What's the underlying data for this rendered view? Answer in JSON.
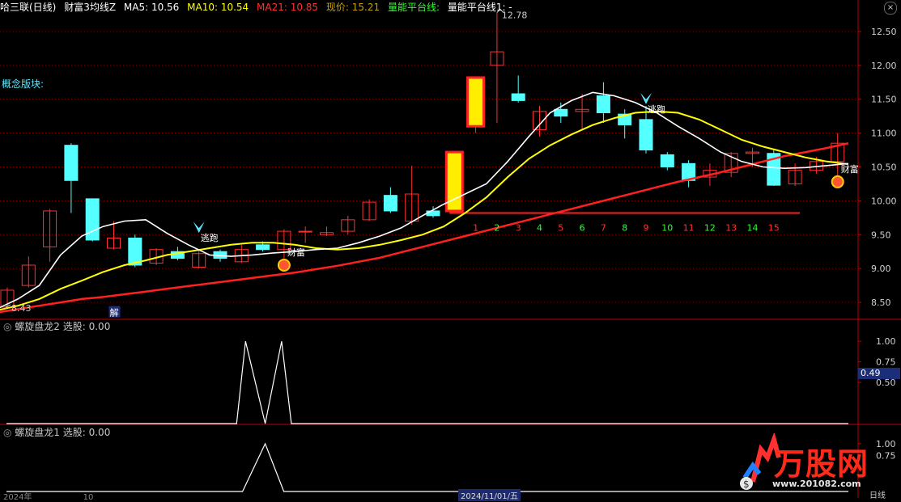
{
  "header": {
    "stock": "哈三联(日线)",
    "indicator": "财富3均线Z",
    "ma5_label": "MA5: 10.56",
    "ma10_label": "MA10: 10.54",
    "ma21_label": "MA21: 10.85",
    "price_label": "现价: 15.21",
    "platform_label": "量能平台线:",
    "platform1_label": "量能平台线1: -",
    "close_glyph": "×"
  },
  "concept_label": "概念版块:",
  "colors": {
    "up": "#ff3030",
    "down": "#54ffff",
    "ma5": "#ffffff",
    "ma10": "#ffff00",
    "ma21": "#ff2020",
    "grid": "#8a0000",
    "axis": "#c00000"
  },
  "chart_data": [
    {
      "type": "candlestick",
      "ylim": [
        8.25,
        12.75
      ],
      "y_ticks": [
        "8.50",
        "9.00",
        "9.50",
        "10.00",
        "10.50",
        "11.00",
        "11.50",
        "12.00",
        "12.50"
      ],
      "candles": [
        {
          "o": 8.43,
          "c": 8.68,
          "h": 8.72,
          "l": 8.43
        },
        {
          "o": 8.75,
          "c": 9.05,
          "h": 9.18,
          "l": 8.72
        },
        {
          "o": 9.32,
          "c": 9.85,
          "h": 9.88,
          "l": 9.1
        },
        {
          "o": 10.82,
          "c": 10.3,
          "h": 10.85,
          "l": 9.82
        },
        {
          "o": 10.03,
          "c": 9.42,
          "h": 10.03,
          "l": 9.4
        },
        {
          "o": 9.3,
          "c": 9.45,
          "h": 9.7,
          "l": 9.28
        },
        {
          "o": 9.45,
          "c": 9.05,
          "h": 9.5,
          "l": 9.02
        },
        {
          "o": 9.08,
          "c": 9.28,
          "h": 9.3,
          "l": 9.05
        },
        {
          "o": 9.25,
          "c": 9.15,
          "h": 9.32,
          "l": 9.12
        },
        {
          "o": 9.02,
          "c": 9.22,
          "h": 9.28,
          "l": 9.0
        },
        {
          "o": 9.25,
          "c": 9.15,
          "h": 9.28,
          "l": 9.1
        },
        {
          "o": 9.1,
          "c": 9.28,
          "h": 9.35,
          "l": 9.08
        },
        {
          "o": 9.35,
          "c": 9.28,
          "h": 9.4,
          "l": 9.25
        },
        {
          "o": 9.28,
          "c": 9.55,
          "h": 9.58,
          "l": 9.15
        },
        {
          "o": 9.55,
          "c": 9.55,
          "h": 9.62,
          "l": 9.38
        },
        {
          "o": 9.5,
          "c": 9.53,
          "h": 9.62,
          "l": 9.48
        },
        {
          "o": 9.55,
          "c": 9.72,
          "h": 9.78,
          "l": 9.5
        },
        {
          "o": 9.72,
          "c": 9.98,
          "h": 10.02,
          "l": 9.7
        },
        {
          "o": 10.08,
          "c": 9.85,
          "h": 10.2,
          "l": 9.82
        },
        {
          "o": 9.7,
          "c": 10.1,
          "h": 10.52,
          "l": 9.65
        },
        {
          "o": 9.85,
          "c": 9.78,
          "h": 9.92,
          "l": 9.75
        },
        {
          "o": 9.85,
          "c": 10.72,
          "h": 10.72,
          "l": 9.85,
          "hl": true
        },
        {
          "o": 11.1,
          "c": 11.82,
          "h": 11.82,
          "l": 11.0,
          "hl": true
        },
        {
          "o": 12.0,
          "c": 12.2,
          "h": 12.78,
          "l": 11.15
        },
        {
          "o": 11.58,
          "c": 11.48,
          "h": 11.85,
          "l": 11.45
        },
        {
          "o": 11.05,
          "c": 11.32,
          "h": 11.4,
          "l": 10.95
        },
        {
          "o": 11.35,
          "c": 11.25,
          "h": 11.45,
          "l": 11.15
        },
        {
          "o": 11.32,
          "c": 11.35,
          "h": 11.58,
          "l": 11.05
        },
        {
          "o": 11.55,
          "c": 11.3,
          "h": 11.75,
          "l": 11.15
        },
        {
          "o": 11.28,
          "c": 11.12,
          "h": 11.35,
          "l": 10.92
        },
        {
          "o": 11.2,
          "c": 10.75,
          "h": 11.4,
          "l": 10.7
        },
        {
          "o": 10.68,
          "c": 10.5,
          "h": 10.72,
          "l": 10.45
        },
        {
          "o": 10.55,
          "c": 10.3,
          "h": 10.6,
          "l": 10.2
        },
        {
          "o": 10.35,
          "c": 10.45,
          "h": 10.55,
          "l": 10.22
        },
        {
          "o": 10.42,
          "c": 10.7,
          "h": 10.72,
          "l": 10.35
        },
        {
          "o": 10.7,
          "c": 10.72,
          "h": 10.78,
          "l": 10.5
        },
        {
          "o": 10.7,
          "c": 10.23,
          "h": 10.75,
          "l": 10.22
        },
        {
          "o": 10.25,
          "c": 10.45,
          "h": 10.55,
          "l": 10.22
        },
        {
          "o": 10.45,
          "c": 10.58,
          "h": 10.65,
          "l": 10.4
        },
        {
          "o": 10.58,
          "c": 10.85,
          "h": 11.0,
          "l": 10.25
        }
      ],
      "ma5": [
        8.4,
        8.55,
        8.75,
        9.2,
        9.48,
        9.62,
        9.7,
        9.72,
        9.52,
        9.35,
        9.2,
        9.18,
        9.2,
        9.23,
        9.25,
        9.28,
        9.3,
        9.38,
        9.48,
        9.6,
        9.78,
        9.95,
        10.1,
        10.25,
        10.58,
        10.95,
        11.3,
        11.48,
        11.6,
        11.55,
        11.45,
        11.3,
        11.1,
        10.92,
        10.72,
        10.58,
        10.5,
        10.48,
        10.49,
        10.52,
        10.55
      ],
      "ma10": [
        8.38,
        8.45,
        8.55,
        8.7,
        8.82,
        8.95,
        9.05,
        9.12,
        9.2,
        9.25,
        9.3,
        9.35,
        9.38,
        9.38,
        9.35,
        9.3,
        9.28,
        9.3,
        9.35,
        9.42,
        9.5,
        9.62,
        9.82,
        10.05,
        10.35,
        10.62,
        10.82,
        10.98,
        11.12,
        11.22,
        11.3,
        11.32,
        11.3,
        11.2,
        11.05,
        10.9,
        10.8,
        10.72,
        10.64,
        10.58,
        10.54
      ],
      "ma21": [
        8.35,
        8.4,
        8.45,
        8.5,
        8.55,
        8.58,
        8.62,
        8.66,
        8.7,
        8.74,
        8.78,
        8.82,
        8.86,
        8.9,
        8.94,
        8.99,
        9.04,
        9.1,
        9.16,
        9.24,
        9.32,
        9.4,
        9.48,
        9.56,
        9.64,
        9.72,
        9.8,
        9.88,
        9.96,
        10.04,
        10.12,
        10.2,
        10.28,
        10.35,
        10.42,
        10.5,
        10.58,
        10.66,
        10.72,
        10.78,
        10.85
      ],
      "support_line": 9.82,
      "count_labels": [
        "1",
        "2",
        "3",
        "4",
        "5",
        "6",
        "7",
        "8",
        "9",
        "10",
        "11",
        "12",
        "13",
        "14",
        "15"
      ],
      "annotations": {
        "high": "12.78",
        "low": "8.43",
        "run1": "逃跑",
        "run2": "逃跑",
        "wealth1": "财富",
        "wealth2": "财富",
        "jie": "解"
      }
    },
    {
      "type": "line",
      "title": "螺旋盘龙2 选股: 0.00",
      "y_ticks": [
        "1.00",
        "0.75",
        "0.50"
      ],
      "ylim": [
        0,
        1.1
      ],
      "marker_value": "0.49",
      "values": [
        0,
        0,
        0,
        0,
        0,
        0,
        0,
        0,
        0,
        0,
        0,
        0,
        0,
        0,
        0,
        0,
        0,
        0,
        0,
        0,
        0,
        0,
        0,
        0,
        0,
        0,
        0,
        0,
        0,
        0,
        0,
        0,
        0,
        0,
        0,
        0,
        0,
        0,
        0,
        0,
        0
      ],
      "peaks": [
        {
          "x": 11,
          "y": 1.0
        },
        {
          "x": 12,
          "y": 0
        },
        {
          "x": 13,
          "y": 1.0
        }
      ]
    },
    {
      "type": "line",
      "title": "螺旋盘龙1 选股: 0.00",
      "y_ticks": [
        "1.00",
        "0.75"
      ],
      "ylim": [
        0,
        1.1
      ],
      "peaks": [
        {
          "x": 12,
          "y": 1.0
        }
      ]
    }
  ],
  "footer": {
    "left": "2024年",
    "left2": "10",
    "mid": "2024/11/01/五",
    "right": "日线"
  },
  "watermark": {
    "brand": "万股网",
    "url": "www.201082.com"
  }
}
